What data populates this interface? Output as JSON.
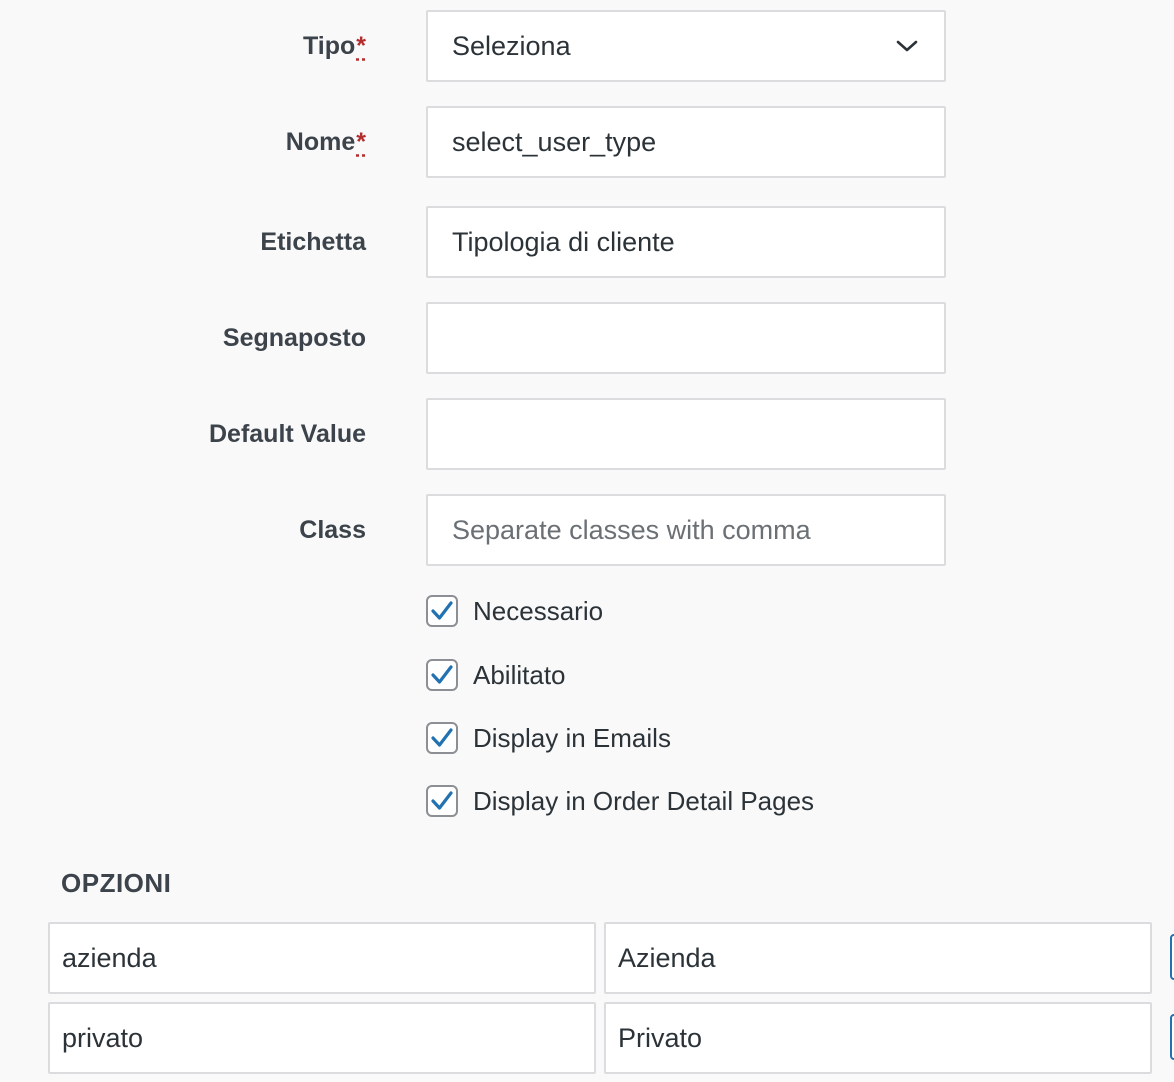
{
  "form": {
    "tipo": {
      "label": "Tipo",
      "required_mark": "*",
      "value": "Seleziona"
    },
    "nome": {
      "label": "Nome",
      "required_mark": "*",
      "value": "select_user_type"
    },
    "etichetta": {
      "label": "Etichetta",
      "value": "Tipologia di cliente"
    },
    "segnaposto": {
      "label": "Segnaposto",
      "value": ""
    },
    "default_value": {
      "label": "Default Value",
      "value": ""
    },
    "class": {
      "label": "Class",
      "value": "",
      "placeholder": "Separate classes with comma"
    }
  },
  "checkboxes": [
    {
      "label": "Necessario",
      "checked": true
    },
    {
      "label": "Abilitato",
      "checked": true
    },
    {
      "label": "Display in Emails",
      "checked": true
    },
    {
      "label": "Display in Order Detail Pages",
      "checked": true
    }
  ],
  "options_section": {
    "title": "OPZIONI",
    "rows": [
      {
        "key": "azienda",
        "label": "Azienda"
      },
      {
        "key": "privato",
        "label": "Privato"
      }
    ]
  },
  "colors": {
    "accent": "#2271b1",
    "required": "#b32d2e",
    "border": "#dcdcde",
    "background": "#f9f9f9"
  },
  "icons": {
    "select_arrow": "chevron-down-icon",
    "checkbox_mark": "checkmark-icon"
  }
}
